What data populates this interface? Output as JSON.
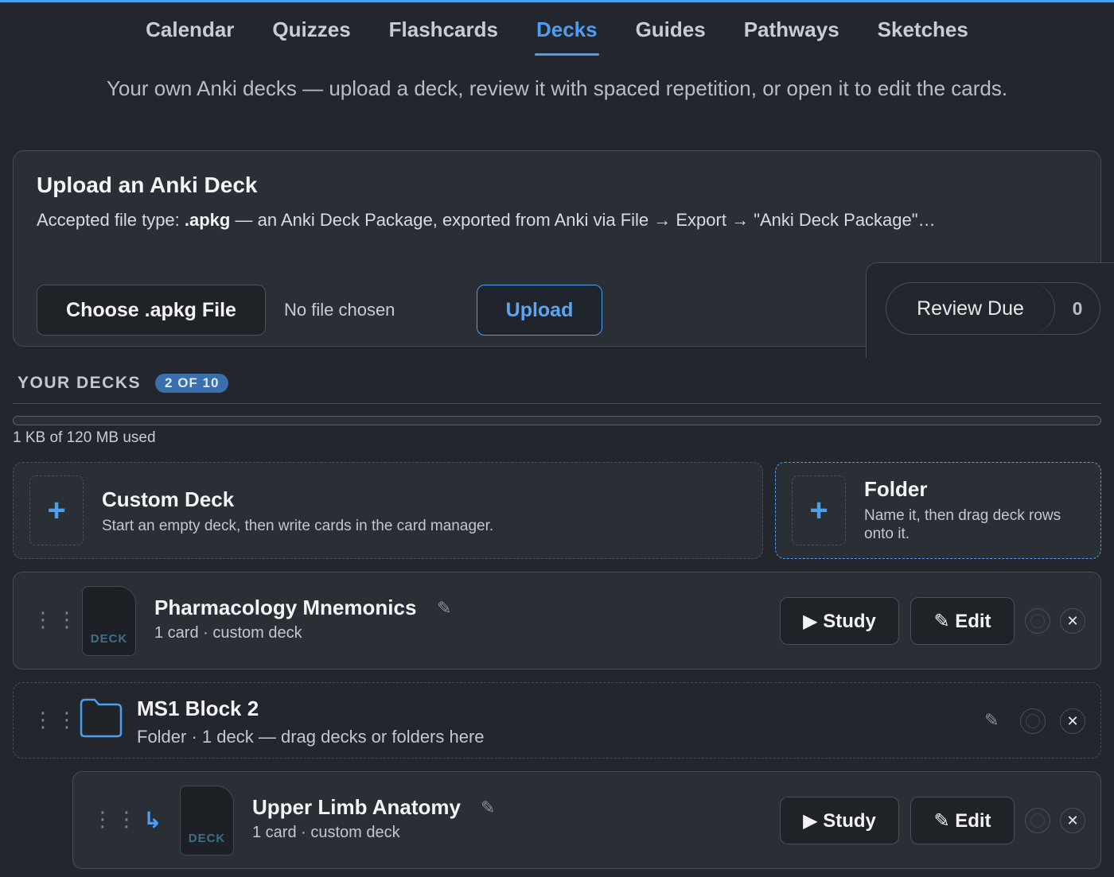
{
  "nav": {
    "items": [
      {
        "label": "Calendar",
        "active": false
      },
      {
        "label": "Quizzes",
        "active": false
      },
      {
        "label": "Flashcards",
        "active": false
      },
      {
        "label": "Decks",
        "active": true
      },
      {
        "label": "Guides",
        "active": false
      },
      {
        "label": "Pathways",
        "active": false
      },
      {
        "label": "Sketches",
        "active": false
      }
    ]
  },
  "subtitle": "Your own Anki decks — upload a deck, review it with spaced repetition, or open it to edit the cards.",
  "upload": {
    "title": "Upload an Anki Deck",
    "desc_prefix": "Accepted file type: ",
    "desc_ext": ".apkg",
    "desc_suffix": " — an Anki Deck Package, exported from Anki via File → Export → \"Anki Deck Package\"…",
    "choose_label": "Choose .apkg File",
    "file_status": "No file chosen",
    "upload_label": "Upload"
  },
  "review": {
    "label": "Review Due",
    "count": "0"
  },
  "decks_section": {
    "title": "YOUR DECKS",
    "badge": "2 OF 10",
    "storage_text": "1 KB of 120 MB used",
    "storage_fraction": 0.0
  },
  "create": {
    "custom": {
      "title": "Custom Deck",
      "desc": "Start an empty deck, then write cards in the card manager."
    },
    "folder": {
      "title": "Folder",
      "desc": "Name it, then drag deck rows onto it."
    }
  },
  "rows": {
    "deck1": {
      "icon_label": "DECK",
      "title": "Pharmacology Mnemonics",
      "meta": "1 card · custom deck",
      "study_label": "▶ Study",
      "edit_label": "✎ Edit"
    },
    "folder1": {
      "title": "MS1 Block 2",
      "meta": "Folder · 1 deck — drag decks or folders here"
    },
    "deck2": {
      "icon_label": "DECK",
      "title": "Upper Limb Anatomy",
      "meta": "1 card · custom deck",
      "study_label": "▶ Study",
      "edit_label": "✎ Edit"
    }
  },
  "colors": {
    "accent": "#4c9ef0",
    "background": "#23262c",
    "card": "#2a2e35"
  },
  "icons": {
    "grip": "drag-handle-icon",
    "pencil": "pencil-icon",
    "folder": "folder-icon",
    "child": "child-arrow-icon",
    "close": "close-icon"
  }
}
